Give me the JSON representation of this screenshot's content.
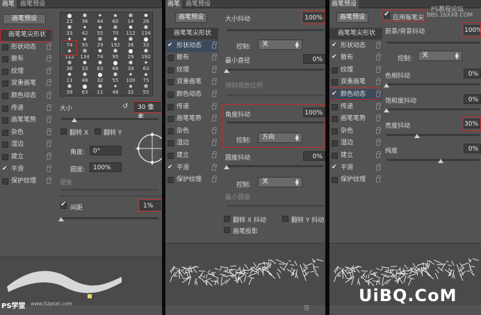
{
  "colors": {
    "panel": "#535353",
    "highlight": "#c62c2c",
    "tab_bar": "#3d3d3d"
  },
  "panel1": {
    "tabs": [
      "画笔",
      "画笔预设"
    ],
    "preset_button": "画笔预设",
    "list": [
      {
        "label": "画笔笔尖形状",
        "checked": false,
        "header": true
      },
      {
        "label": "形状动态",
        "checked": false
      },
      {
        "label": "散布",
        "checked": false
      },
      {
        "label": "纹理",
        "checked": false
      },
      {
        "label": "双重画笔",
        "checked": false
      },
      {
        "label": "颜色动态",
        "checked": false
      },
      {
        "label": "传递",
        "checked": false
      },
      {
        "label": "画笔笔势",
        "checked": false
      },
      {
        "label": "杂色",
        "checked": false
      },
      {
        "label": "湿边",
        "checked": false
      },
      {
        "label": "建立",
        "checked": false
      },
      {
        "label": "平滑",
        "checked": true
      },
      {
        "label": "保护纹理",
        "checked": false
      }
    ],
    "brush_grid": [
      [
        "23",
        "36",
        "44",
        "60",
        "14",
        "26"
      ],
      [
        "33",
        "42",
        "55",
        "70",
        "112",
        "134"
      ],
      [
        "74",
        "95",
        "29",
        "192",
        "36",
        "33"
      ],
      [
        "112",
        "134",
        "74",
        "95",
        "29",
        "192"
      ],
      [
        "36",
        "33",
        "63",
        "66",
        "39",
        "63"
      ],
      [
        "11",
        "48",
        "32",
        "55",
        "100",
        "75"
      ],
      [
        "39",
        "63",
        "11",
        "48",
        "32",
        "55"
      ]
    ],
    "size_label": "大小",
    "size_value": "30 像素",
    "flip_x": "翻转 X",
    "flip_y": "翻转 Y",
    "angle_label": "角度:",
    "angle_value": "0°",
    "roundness_label": "圆度:",
    "roundness_value": "100%",
    "hardness_label": "硬度",
    "spacing_label": "间距",
    "spacing_checked": true,
    "spacing_value": "1%",
    "watermark": "PS学堂",
    "watermark_url": "www.52psxt.com"
  },
  "panel2": {
    "tabs": [
      "画笔",
      "画笔预设"
    ],
    "preset_button": "画笔预设",
    "list": [
      {
        "label": "画笔笔尖形状",
        "checked": false,
        "header": true
      },
      {
        "label": "形状动态",
        "checked": true,
        "selected": true
      },
      {
        "label": "散布",
        "checked": false
      },
      {
        "label": "纹理",
        "checked": false
      },
      {
        "label": "双重画笔",
        "checked": false
      },
      {
        "label": "颜色动态",
        "checked": false
      },
      {
        "label": "传递",
        "checked": false
      },
      {
        "label": "画笔笔势",
        "checked": false
      },
      {
        "label": "杂色",
        "checked": false
      },
      {
        "label": "湿边",
        "checked": false
      },
      {
        "label": "建立",
        "checked": false
      },
      {
        "label": "平滑",
        "checked": true
      },
      {
        "label": "保护纹理",
        "checked": false
      }
    ],
    "size_jitter_label": "大小抖动",
    "size_jitter_value": "100%",
    "control_label": "控制:",
    "control1": "关",
    "min_diameter_label": "最小直径",
    "min_diameter_value": "0%",
    "tilt_scale_label": "倾斜缩放比例",
    "angle_jitter_label": "角度抖动",
    "angle_jitter_value": "100%",
    "control2": "方向",
    "roundness_jitter_label": "圆度抖动",
    "roundness_jitter_value": "0%",
    "control3": "关",
    "min_roundness_label": "最小圆度",
    "flip_x_jitter": "翻转 X 抖动",
    "flip_y_jitter": "翻转 Y 抖动",
    "brush_projection": "画笔投影"
  },
  "panel3": {
    "tabs": [
      "画笔预设"
    ],
    "preset_button": "画笔预设",
    "apply_per_tip": "应用每笔尖",
    "list": [
      {
        "label": "画笔笔尖形状",
        "checked": false,
        "header": true
      },
      {
        "label": "形状动态",
        "checked": true
      },
      {
        "label": "散布",
        "checked": true
      },
      {
        "label": "纹理",
        "checked": false
      },
      {
        "label": "双重画笔",
        "checked": false
      },
      {
        "label": "颜色动态",
        "checked": true,
        "selected": true
      },
      {
        "label": "传递",
        "checked": false
      },
      {
        "label": "画笔笔势",
        "checked": false
      },
      {
        "label": "杂色",
        "checked": false
      },
      {
        "label": "湿边",
        "checked": false
      },
      {
        "label": "建立",
        "checked": false
      },
      {
        "label": "平滑",
        "checked": true
      },
      {
        "label": "保护纹理",
        "checked": false
      }
    ],
    "fg_bg_jitter_label": "前景/背景抖动",
    "fg_bg_jitter_value": "100%",
    "control_label": "控制:",
    "control": "关",
    "hue_jitter_label": "色相抖动",
    "hue_jitter_value": "0%",
    "saturation_jitter_label": "饱和度抖动",
    "saturation_jitter_value": "0%",
    "brightness_jitter_label": "亮度抖动",
    "brightness_jitter_value": "30%",
    "purity_label": "纯度",
    "purity_value": "0%",
    "site_watermark": "PS教程论坛",
    "site_url": "BBS.16XX8.COM",
    "brand": "UiBQ.CoM"
  }
}
